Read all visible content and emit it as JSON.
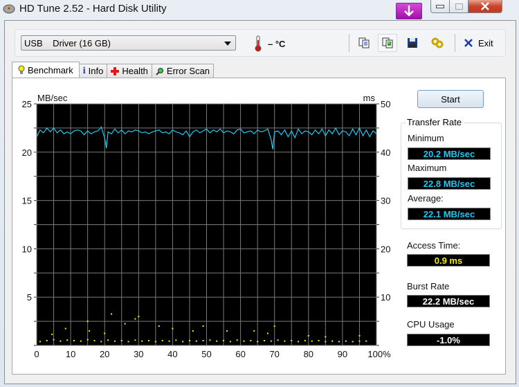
{
  "window": {
    "title": "HD Tune 2.52 - Hard Disk Utility",
    "controls": {
      "minimize": "minimize",
      "maximize": "maximize",
      "close": "close"
    }
  },
  "toolbar": {
    "drive_selected": "USB    Driver (16 GB)",
    "temperature": "– °C",
    "icons": [
      "copy-text-icon",
      "copy-screenshot-icon",
      "save-icon",
      "options-icon"
    ],
    "exit_label": "Exit"
  },
  "tabs": [
    {
      "label": "Benchmark",
      "icon": "lightbulb-icon",
      "active": true
    },
    {
      "label": "Info",
      "icon": "info-icon",
      "active": false
    },
    {
      "label": "Health",
      "icon": "health-cross-icon",
      "active": false
    },
    {
      "label": "Error Scan",
      "icon": "magnifier-icon",
      "active": false
    }
  ],
  "benchmark": {
    "start_label": "Start",
    "transfer_rate": {
      "title": "Transfer Rate",
      "minimum_label": "Minimum",
      "minimum_value": "20.2 MB/sec",
      "maximum_label": "Maximum",
      "maximum_value": "22.8 MB/sec",
      "average_label": "Average:",
      "average_value": "22.1 MB/sec"
    },
    "access_time_label": "Access Time:",
    "access_time_value": "0.9 ms",
    "burst_rate_label": "Burst Rate",
    "burst_rate_value": "22.2 MB/sec",
    "cpu_usage_label": "CPU Usage",
    "cpu_usage_value": "-1.0%"
  },
  "colors": {
    "transfer_line": "#1fc8f0",
    "access_points": "#f4f000",
    "value_cyan": "#1fc8f0",
    "value_yellow": "#f4f000",
    "value_white": "#ffffff"
  },
  "chart_data": {
    "type": "line",
    "xlabel": "",
    "y_left_label": "MB/sec",
    "y_right_label": "ms",
    "x_ticks": [
      "0",
      "10",
      "20",
      "30",
      "40",
      "50",
      "60",
      "70",
      "80",
      "90",
      "100%"
    ],
    "y_left_ticks": [
      "5",
      "10",
      "15",
      "20",
      "25"
    ],
    "y_right_ticks": [
      "10",
      "20",
      "30",
      "40",
      "50"
    ],
    "xlim": [
      0,
      100
    ],
    "y_left_lim": [
      0,
      25
    ],
    "y_right_lim": [
      0,
      50
    ],
    "grid": true,
    "series": [
      {
        "name": "Transfer Rate (MB/sec)",
        "axis": "left",
        "x": [
          0,
          1,
          2,
          3,
          4,
          5,
          6,
          7,
          8,
          9,
          10,
          11,
          12,
          13,
          14,
          15,
          16,
          17,
          18,
          19,
          20,
          20.5,
          21,
          22,
          23,
          24,
          25,
          26,
          27,
          28,
          29,
          30,
          31,
          32,
          33,
          34,
          35,
          36,
          37,
          38,
          39,
          40,
          41,
          42,
          43,
          44,
          45,
          46,
          47,
          48,
          49,
          50,
          51,
          52,
          53,
          54,
          55,
          56,
          57,
          58,
          59,
          60,
          61,
          62,
          63,
          64,
          65,
          66,
          67,
          68,
          69,
          69.5,
          70,
          71,
          72,
          73,
          74,
          75,
          76,
          77,
          78,
          79,
          80,
          81,
          82,
          83,
          84,
          85,
          86,
          87,
          88,
          89,
          90,
          91,
          92,
          93,
          94,
          95,
          96,
          97,
          98,
          99,
          100
        ],
        "values": [
          21.6,
          22.3,
          22.0,
          22.5,
          22.1,
          22.5,
          22.0,
          22.3,
          21.9,
          22.1,
          21.9,
          22.2,
          22.3,
          22.2,
          21.8,
          22.2,
          21.9,
          22.1,
          22.2,
          22.6,
          21.5,
          20.4,
          22.1,
          21.9,
          22.4,
          22.0,
          22.3,
          21.9,
          22.2,
          22.1,
          22.3,
          22.2,
          22.0,
          22.1,
          21.9,
          22.1,
          22.2,
          22.3,
          22.0,
          22.1,
          21.9,
          22.3,
          22.1,
          22.0,
          21.8,
          22.2,
          21.6,
          22.1,
          22.3,
          22.0,
          22.2,
          22.4,
          22.0,
          22.3,
          22.1,
          22.4,
          22.0,
          22.2,
          22.1,
          21.9,
          22.3,
          22.4,
          22.0,
          22.1,
          22.2,
          21.9,
          22.3,
          22.1,
          22.2,
          22.4,
          21.3,
          20.3,
          22.1,
          22.2,
          21.8,
          22.3,
          21.6,
          22.2,
          21.5,
          22.4,
          21.9,
          22.2,
          22.1,
          21.8,
          22.3,
          21.9,
          22.4,
          21.7,
          22.3,
          21.9,
          22.5,
          21.8,
          22.2,
          22.1,
          21.7,
          22.4,
          21.8,
          22.5,
          21.7,
          22.3,
          21.6,
          22.2,
          21.9
        ]
      },
      {
        "name": "Access Time (ms)",
        "axis": "right",
        "style": "scatter",
        "x": [
          1,
          3,
          5,
          7,
          9,
          11,
          13,
          15,
          17,
          19,
          21,
          23,
          25,
          27,
          29,
          31,
          33,
          35,
          37,
          39,
          41,
          43,
          45,
          47,
          49,
          51,
          53,
          55,
          57,
          59,
          61,
          63,
          65,
          67,
          69,
          71,
          73,
          75,
          77,
          79,
          81,
          83,
          85,
          87,
          89,
          91,
          93,
          95,
          97,
          4.5,
          8.5,
          15,
          15.5,
          20,
          22,
          26,
          29,
          30,
          36,
          40,
          46,
          49,
          56,
          64,
          68,
          70,
          80,
          85,
          95
        ],
        "values": [
          0.8,
          1.0,
          1.2,
          0.9,
          1.1,
          1.0,
          0.9,
          1.2,
          1.0,
          0.8,
          1.1,
          0.9,
          1.0,
          0.8,
          1.1,
          0.9,
          1.0,
          0.8,
          1.0,
          0.9,
          1.1,
          0.8,
          1.0,
          0.9,
          1.0,
          1.1,
          0.9,
          1.0,
          0.8,
          1.1,
          0.9,
          1.0,
          0.8,
          1.0,
          0.9,
          1.1,
          0.9,
          1.0,
          0.8,
          1.0,
          0.9,
          1.0,
          0.8,
          0.9,
          0.8,
          0.9,
          0.8,
          0.9,
          0.9,
          2.3,
          3.5,
          5.0,
          3.0,
          2.5,
          6.5,
          4.5,
          5.5,
          6.0,
          4.0,
          3.5,
          3.0,
          4.0,
          3.0,
          3.0,
          2.5,
          4.0,
          2.0,
          1.8,
          2.0
        ]
      }
    ]
  }
}
